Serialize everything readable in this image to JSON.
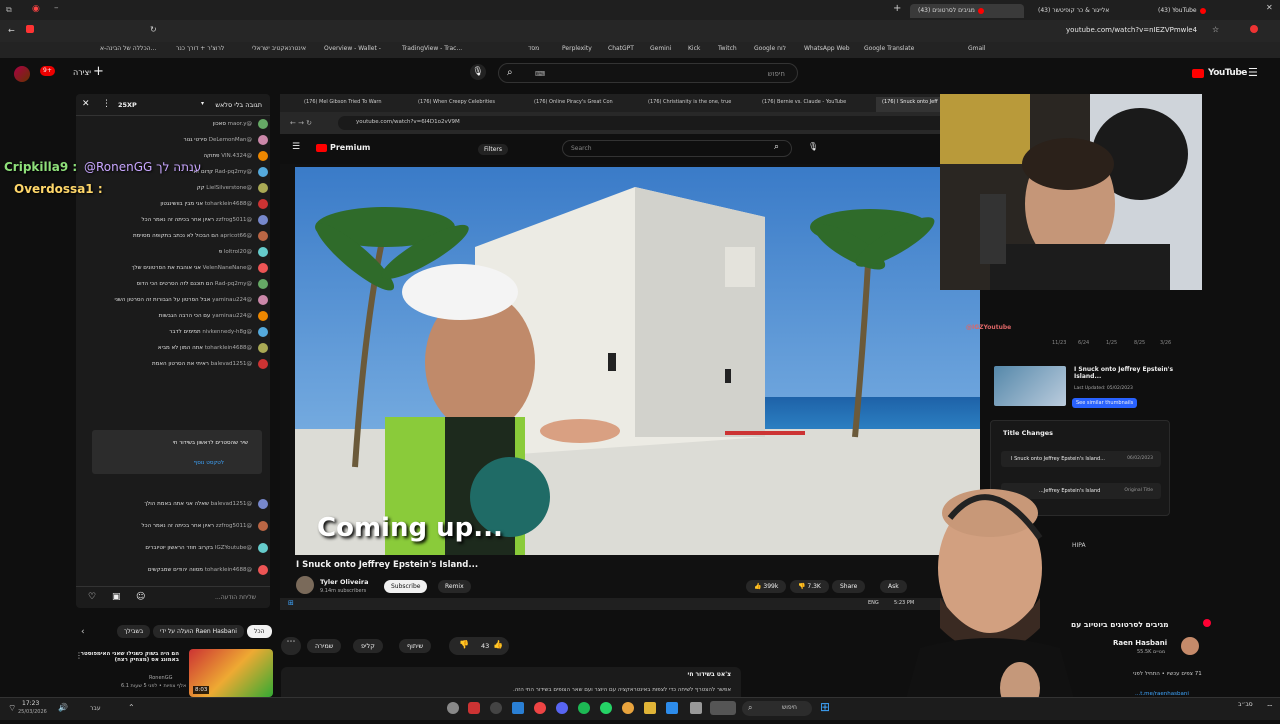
{
  "browser": {
    "tabs": [
      {
        "label": "מגיבים לסרטונים (43)"
      },
      {
        "label": "אלייגור & כר קופיטשר (43)"
      },
      {
        "label": "(43) YouTube"
      }
    ],
    "url": "youtube.com/watch?v=nIEZVPmwle4",
    "bookmarks": [
      "Gmail",
      "Google Translate",
      "WhatsApp Web",
      "Google לוח",
      "Twitch",
      "Kick",
      "Gemini",
      "ChatGPT",
      "Perplexity",
      "מסד",
      "TradingView - Trac...",
      "Overview - Wallet -",
      "אינטרנאקטיב ישראלי",
      "לרוצ'ר + דורך כנר",
      "הכללה של הבינה-א..."
    ]
  },
  "yt_header": {
    "logo": "YouTube",
    "search_placeholder": "חיפוש",
    "create_label": "יצירה",
    "notif_count": "9+"
  },
  "chat": {
    "title": "תגובה בלי סלאש",
    "xp": "25XP",
    "overlay1_user": "Cripkilla9 :",
    "overlay1_text": "@RonenGG ענתה לך",
    "overlay2_user": "Overdossa1 :",
    "messages": [
      {
        "user": "@maor.y",
        "text": "סאכון"
      },
      {
        "user": "@DeLemonMan",
        "text": "סירטי גנור"
      },
      {
        "user": "@4324.VIN",
        "text": "פתוקה"
      },
      {
        "user": "@Rad-pq2my",
        "text": "קדום אני"
      },
      {
        "user": "@LielSilverstone",
        "text": "קק"
      },
      {
        "user": "@toharklein4688",
        "text": "אני מבין בוושינגטון"
      },
      {
        "user": "@zzfrog5011",
        "text": "ראיון אחר בכיתה זה נאמר הכל"
      },
      {
        "user": "@apricot66",
        "text": "הם הבכול לא נכתב בתקופה מסוימת"
      },
      {
        "user": "@loltrol20",
        "text": "פ"
      },
      {
        "user": "@VelenNaneNane",
        "text": "אני אוהבת את הסרטונים שלך"
      },
      {
        "user": "@Rad-pq2my",
        "text": "הם תוכנם לזה הסרטים הכי הדוס"
      },
      {
        "user": "@yaminau224",
        "text": "אבל הסרטון על הגבורות זה הסרטון השני"
      },
      {
        "user": "@yaminau224",
        "text": "עם הכי הרבה הגבשות"
      },
      {
        "user": "@nivkennedy-h8g",
        "text": "תמימים לדבר"
      },
      {
        "user": "@toharklein4688",
        "text": "אתה המון לא מביא"
      },
      {
        "user": "@balevad1251",
        "text": "ראיתי את הסרטון האמת"
      },
      {
        "user": "@balevad1251",
        "text": "שאלה אני אתה באמת הולך"
      },
      {
        "user": "@zzfrog5011",
        "text": "ראיון אחר בכיתה זה נאמר הכל"
      },
      {
        "user": "@IGZYoutube",
        "text": "בקרוב חוזר הראשון יוטיוברים"
      },
      {
        "user": "@toharklein4688",
        "text": "מסווה יהודים שמבקשים"
      }
    ],
    "pinned": "שיר שהסטרים לראשון בשידור חי",
    "pinned_link": "לטקסט נוסף",
    "input_placeholder": "...שליחת הודעה"
  },
  "stream_browser": {
    "tabs": [
      "(176) Mel Gibson Tried To Warn",
      "(176) When Creepy Celebrities",
      "(176) Online Piracy's Great Con",
      "(176) Christianity is the one, true",
      "(176) Bernie vs. Claude - YouTube",
      "(176) I Snuck onto Jeff"
    ],
    "url": "youtube.com/watch?v=6I4D1o2vV9M",
    "logo": "Premium",
    "filters": "Filters",
    "search_placeholder": "Search"
  },
  "video": {
    "caption": "Coming up...",
    "title": "I Snuck onto Jeffrey Epstein's Island...",
    "channel": "Tyler Oliveira",
    "subs": "9.14m subscribers",
    "subscribe": "Subscribe",
    "remix": "Remix",
    "likes": "399k",
    "dislikes": "7.3K",
    "share": "Share",
    "ask": "Ask"
  },
  "stream_taskbar": {
    "time": "5:23 PM",
    "lang": "ENG"
  },
  "side_info": {
    "thumb_title": "I Snuck onto Jeffrey Epstein's Island...",
    "thumb_date": "Last Updated: 05/02/2023",
    "similar_button": "See similar thumbnails",
    "changes_title": "Title Changes",
    "row1": "I Snuck onto Jeffrey Epstein's Island...",
    "row1_date": "06/02/2023",
    "row2": "...Jeffrey Epstein's Island",
    "row2_tag": "Original Title",
    "dates": [
      "11/23",
      "6/24",
      "1/25",
      "8/25",
      "3/26"
    ],
    "stream_tag": "@IGZYoutube",
    "hipa": "HIPA"
  },
  "below": {
    "chips": [
      "הכל",
      "הועלה על ידי Raen Hasbani",
      "בשבילך"
    ],
    "rec_title": "הם היה בשוק כשגילו שאני האימפוסטר באמונג אס (מצחיק רצח)",
    "rec_channel": "RonenGG",
    "rec_meta": "6.1 אלף צפיות • לפני 5 שעות",
    "rec_duration": "8:03",
    "actions": {
      "like": "43",
      "share": "שיתוף",
      "clip": "קליפ",
      "save": "שמירה"
    },
    "desc1": "צ'אט בשידור חי",
    "desc2": "אפשר להצטרף לשיחה כדי לצפות באינטראקציה עם היוצר ועם שאר הצופים בשידור החי הזה.",
    "channel_title": "מגיבים לסרטונים ביוטיוב עם",
    "channel_name": "Raen Hasbani",
    "channel_subs": "55.5K מנויים",
    "views_line": "71 צפים עכשיו • התחיל לפני",
    "link": "...t.me/raenhasbani"
  },
  "os": {
    "time": "17:23",
    "date": "25/03/2026",
    "search": "חיפוש",
    "weather": "עבר"
  }
}
